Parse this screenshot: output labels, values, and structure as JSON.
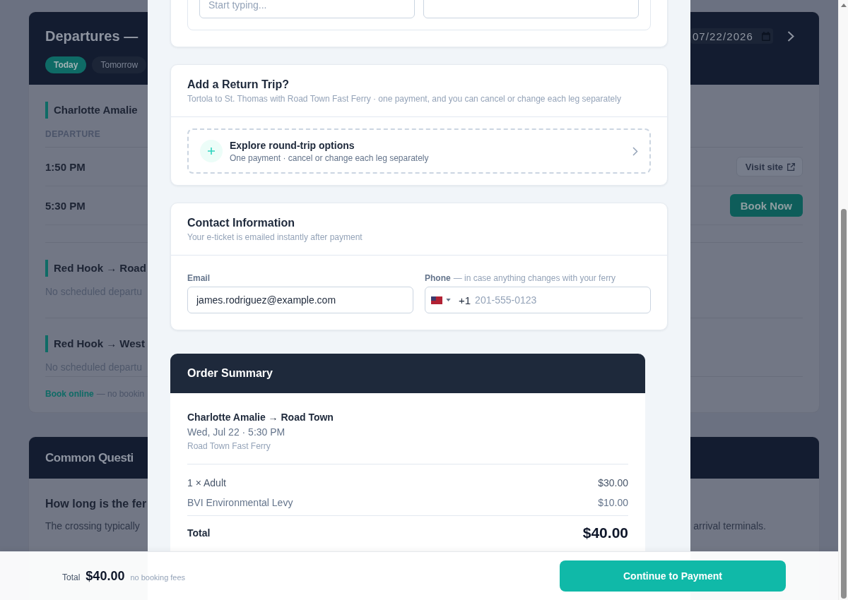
{
  "departures": {
    "title": "Departures —",
    "day_chips": [
      {
        "label": "Today",
        "selected": true
      },
      {
        "label": "Tomorrow",
        "selected": false
      }
    ],
    "date": "07/22/2026",
    "routes": [
      {
        "title": "Charlotte Amalie",
        "column_header": "DEPARTURE",
        "departures": [
          {
            "time": "1:50 PM",
            "action": {
              "kind": "visit",
              "label": "Visit site"
            }
          },
          {
            "time": "5:30 PM",
            "action": {
              "kind": "book",
              "label": "Book Now"
            }
          }
        ]
      },
      {
        "title": "Red Hook → Road",
        "empty_note": "No scheduled departu"
      },
      {
        "title": "Red Hook → West",
        "empty_note": "No scheduled departu"
      }
    ],
    "footer": {
      "link": "Book online",
      "note": "— no bookin"
    }
  },
  "faq": {
    "title": "Common Questi",
    "items": [
      {
        "question": "How long is the fer",
        "answer_start": "The crossing typically",
        "answer_end": "arrival terminals."
      }
    ]
  },
  "booking_modal": {
    "partial_card": {
      "fields": [
        {
          "kind": "text",
          "placeholder": "Start typing..."
        },
        {
          "kind": "text"
        }
      ]
    },
    "return_trip": {
      "title": "Add a Return Trip?",
      "subtitle": "Tortola to St. Thomas with Road Town Fast Ferry · one payment, and you can cancel or change each leg separately",
      "option": {
        "title": "Explore round-trip options",
        "subtitle": "One payment · cancel or change each leg separately"
      }
    },
    "contact": {
      "title": "Contact Information",
      "subtitle": "Your e-ticket is emailed instantly after payment",
      "fields": [
        {
          "kind": "email",
          "label": "Email",
          "value": "james.rodriguez@example.com"
        },
        {
          "kind": "phone",
          "label": "Phone",
          "hint": "— in case anything changes with your ferry",
          "dial_code": "+1",
          "placeholder": "201-555-0123"
        }
      ]
    },
    "order_summary": {
      "title": "Order Summary",
      "trip": {
        "route": "Charlotte Amalie → Road Town",
        "when": "Wed, Jul 22 · 5:30 PM",
        "operator": "Road Town Fast Ferry"
      },
      "lines": [
        {
          "kind": "fare",
          "label": "1 × Adult",
          "amount": "$30.00"
        },
        {
          "kind": "fee",
          "label": "BVI Environmental Levy",
          "amount": "$10.00"
        }
      ],
      "total": {
        "label": "Total",
        "amount": "$40.00"
      }
    }
  },
  "checkout_bar": {
    "total_label": "Total",
    "total": "$40.00",
    "note": "no booking fees",
    "button": "Continue to Payment"
  }
}
